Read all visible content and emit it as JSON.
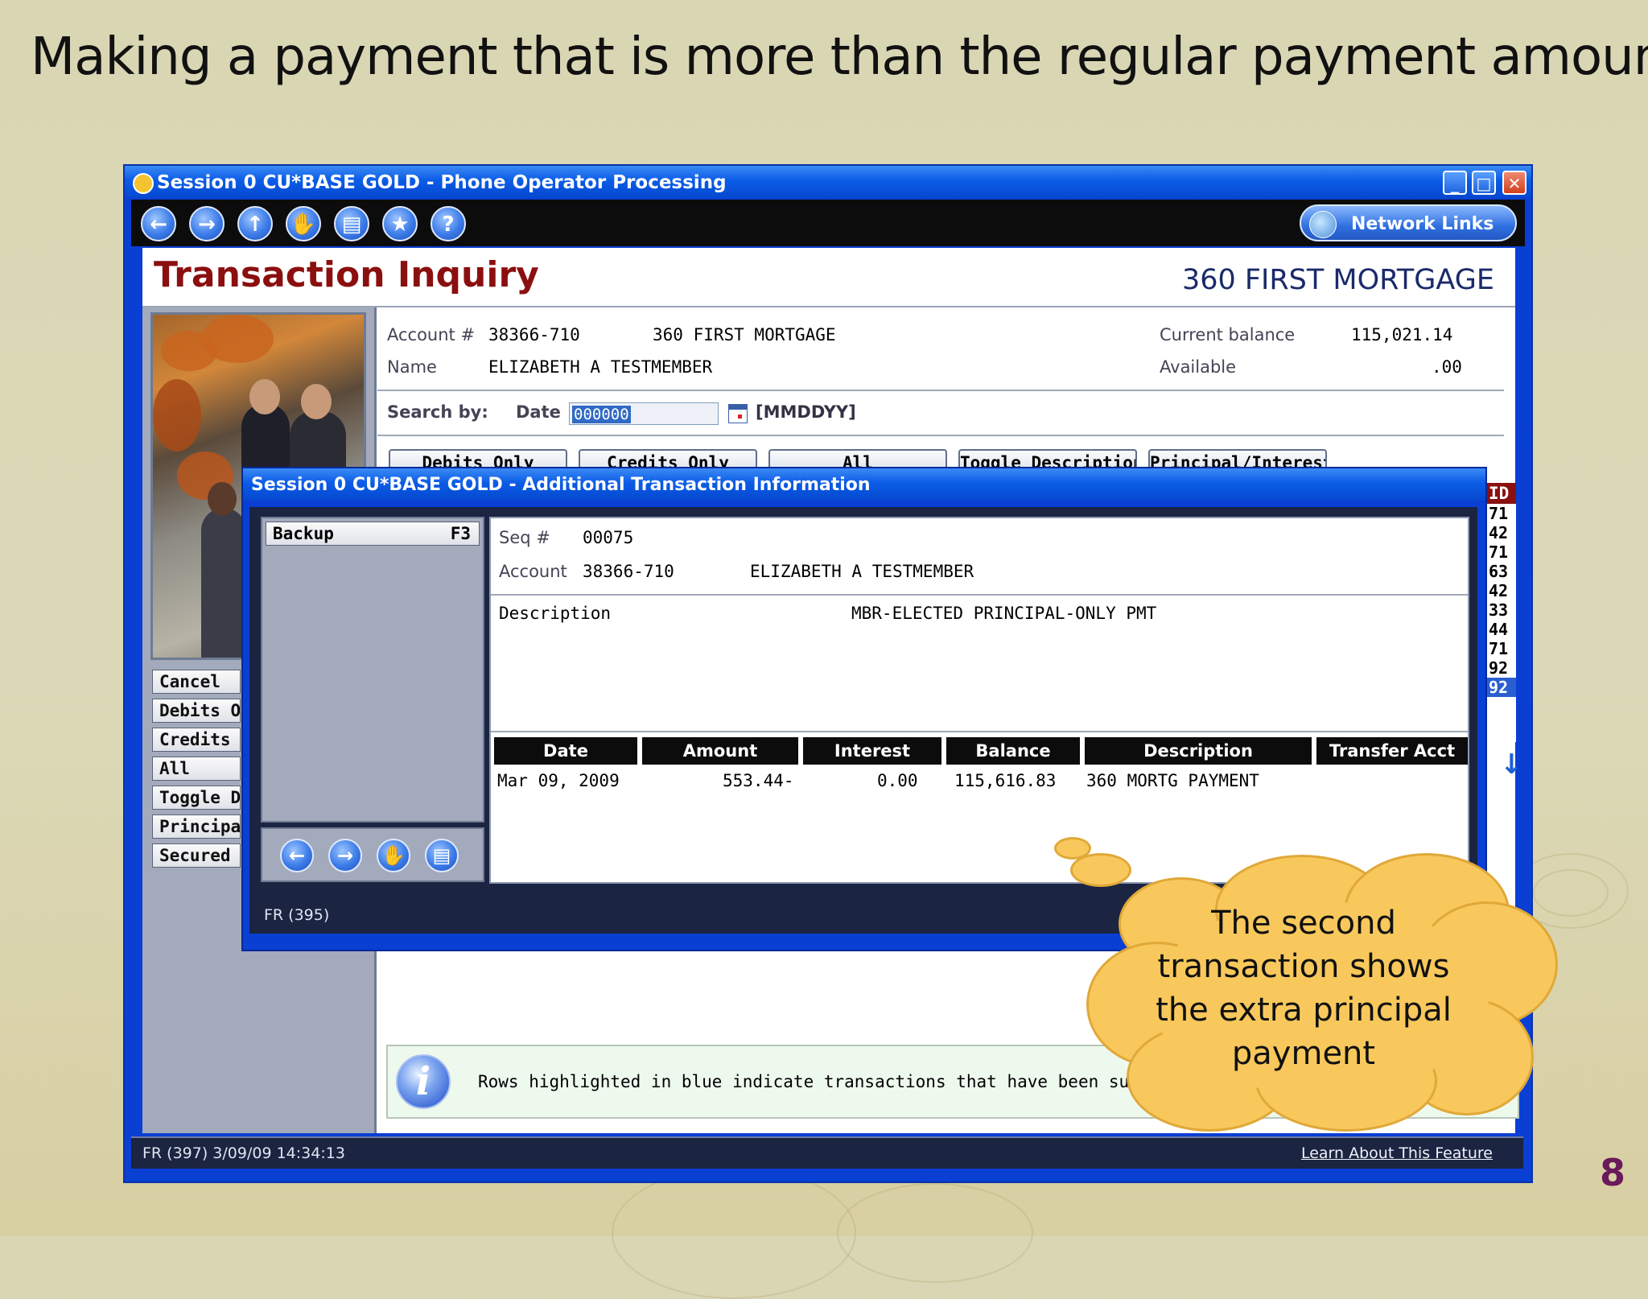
{
  "slide": {
    "title": "Making a payment that is more than the regular payment amount",
    "page_number": "8"
  },
  "window": {
    "title": "Session 0 CU*BASE GOLD - Phone Operator Processing",
    "network_links": "Network Links"
  },
  "header": {
    "page_title": "Transaction Inquiry",
    "account_type": "360 FIRST MORTGAGE"
  },
  "account": {
    "account_label": "Account #",
    "account_number": "38366-710",
    "account_desc": "360 FIRST MORTGAGE",
    "name_label": "Name",
    "name": "ELIZABETH A TESTMEMBER",
    "current_balance_label": "Current balance",
    "current_balance": "115,021.14",
    "available_label": "Available",
    "available": ".00"
  },
  "search": {
    "label": "Search by:",
    "date_label": "Date",
    "date_value": "000000",
    "format_hint": "[MMDDYY]"
  },
  "tabs": [
    "Debits Only",
    "Credits Only",
    "All",
    "Toggle Description",
    "Principal/Interest"
  ],
  "sidebar_buttons": [
    "Cancel",
    "Debits On",
    "Credits O",
    "All",
    "Toggle De",
    "Principal/",
    "Secured I"
  ],
  "id_column": {
    "header": "ID",
    "rows": [
      "71",
      "42",
      "71",
      "63",
      "42",
      "33",
      "44",
      "71",
      "92",
      "92"
    ]
  },
  "info_bar": {
    "text": "Rows highlighted in blue indicate transactions that have been suppressed fro"
  },
  "status_bar": {
    "left": "FR (397) 3/09/09 14:34:13",
    "right": "Learn About This Feature"
  },
  "dialog": {
    "title": "Session 0 CU*BASE GOLD - Additional Transaction Information",
    "backup_label": "Backup",
    "backup_key": "F3",
    "seq_label": "Seq #",
    "seq_value": "00075",
    "account_label": "Account",
    "account_number": "38366-710",
    "account_name": "ELIZABETH A TESTMEMBER",
    "description_label": "Description",
    "description_value": "MBR-ELECTED PRINCIPAL-ONLY PMT",
    "columns": [
      "Date",
      "Amount",
      "Interest",
      "Balance",
      "Description",
      "Transfer Acct"
    ],
    "row": {
      "date": "Mar 09, 2009",
      "amount": "553.44-",
      "interest": "0.00",
      "balance": "115,616.83",
      "description": "360 MORTG PAYMENT",
      "transfer_acct": ""
    },
    "status": "FR (395)"
  },
  "callout": {
    "line1": "The second",
    "line2": "transaction shows",
    "line3": "the extra principal",
    "line4": "payment"
  },
  "colors": {
    "title_red": "#8b0f0f",
    "xp_blue": "#0a3fd4",
    "cloud_yellow": "#f8c85c"
  }
}
